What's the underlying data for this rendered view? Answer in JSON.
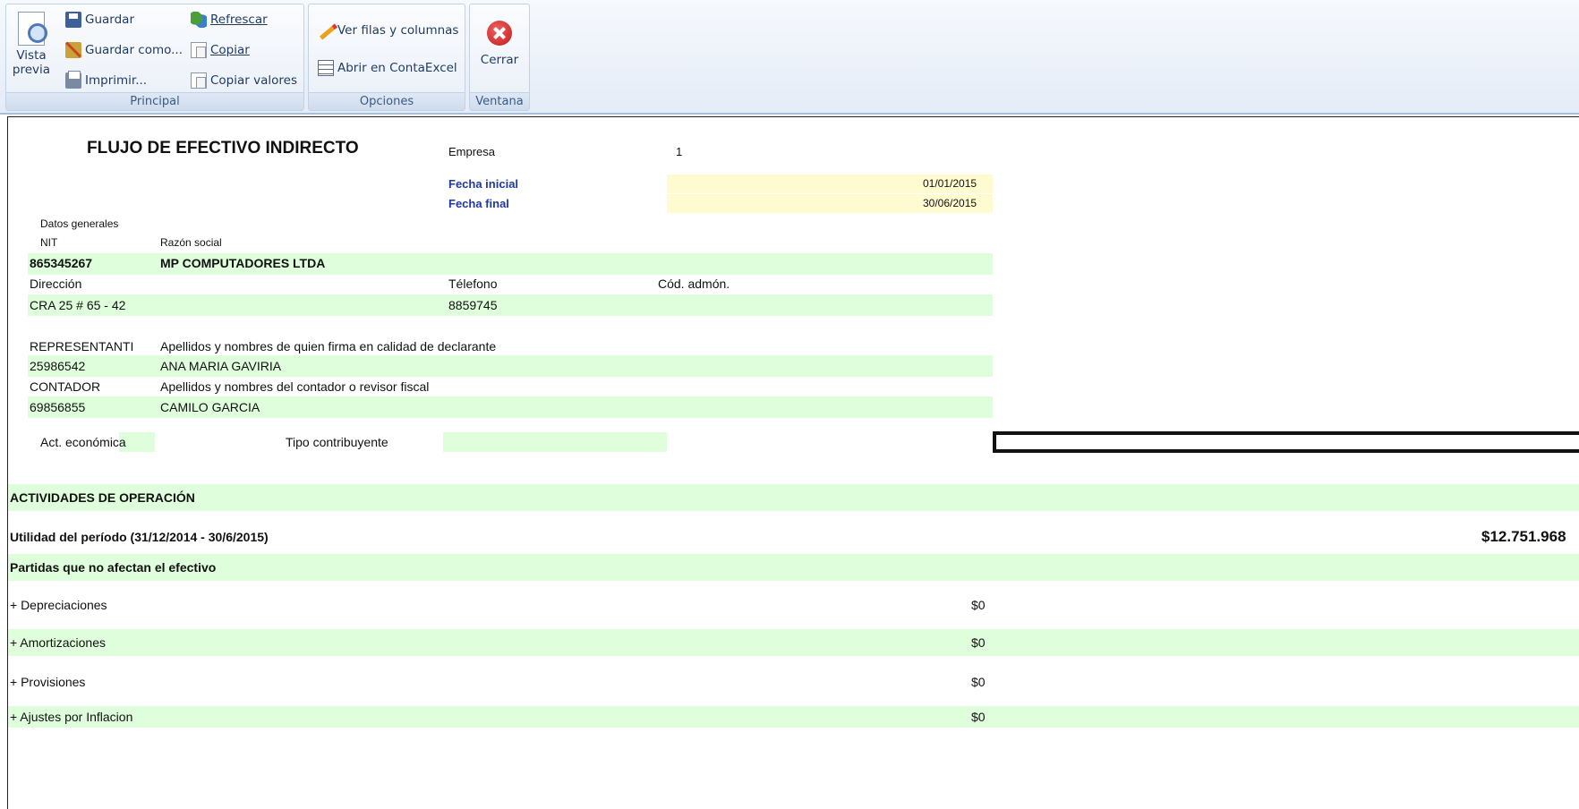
{
  "ribbon": {
    "principal": {
      "vista_previa_line1": "Vista",
      "vista_previa_line2": "previa",
      "guardar": "Guardar",
      "guardar_como": "Guardar como...",
      "imprimir": "Imprimir...",
      "refrescar": "Refrescar",
      "copiar": "Copiar",
      "copiar_valores": "Copiar valores",
      "label": "Principal"
    },
    "opciones": {
      "ver_filas": "Ver filas y columnas",
      "abrir_contaexcel": "Abrir en ContaExcel",
      "label": "Opciones"
    },
    "ventana": {
      "cerrar": "Cerrar",
      "label": "Ventana"
    }
  },
  "report": {
    "title": "FLUJO DE EFECTIVO INDIRECTO",
    "empresa_label": "Empresa",
    "empresa_value": "1",
    "fecha_inicial_label": "Fecha inicial",
    "fecha_inicial_value": "01/01/2015",
    "fecha_final_label": "Fecha final",
    "fecha_final_value": "30/06/2015",
    "datos_generales": "Datos generales",
    "nit_label": "NIT",
    "razon_social_label": "Razón social",
    "nit_value": "865345267",
    "razon_social_value": "MP COMPUTADORES LTDA",
    "direccion_label": "Dirección",
    "telefono_label": "Télefono",
    "cod_admon_label": "Cód. admón.",
    "direccion_value": "CRA 25 # 65 - 42",
    "telefono_value": "8859745",
    "representante_label": "REPRESENTANTI",
    "representante_desc": "Apellidos y nombres de quien firma en calidad de declarante",
    "representante_id": "25986542",
    "representante_name": "ANA MARIA GAVIRIA",
    "contador_label": "CONTADOR",
    "contador_desc": "Apellidos y nombres del contador o revisor fiscal",
    "contador_id": "69856855",
    "contador_name": "CAMILO GARCIA",
    "act_economica_label": "Act. económica",
    "tipo_contribuyente_label": "Tipo contribuyente"
  },
  "sections": {
    "actividades_operacion": "ACTIVIDADES DE OPERACIÓN",
    "utilidad_label": "Utilidad del período  (31/12/2014 - 30/6/2015)",
    "utilidad_value": "$12.751.968",
    "partidas_label": "Partidas que no afectan el efectivo",
    "rows": [
      {
        "label": "+ Depreciaciones",
        "value": "$0"
      },
      {
        "label": "+ Amortizaciones",
        "value": "$0"
      },
      {
        "label": "+ Provisiones",
        "value": "$0"
      },
      {
        "label": "+ Ajustes por Inflacion",
        "value": "$0"
      }
    ]
  },
  "colors": {
    "green_fill": "#dfffdc",
    "yellow_fill": "#fffbd0",
    "date_label_blue": "#1f3a9e"
  }
}
